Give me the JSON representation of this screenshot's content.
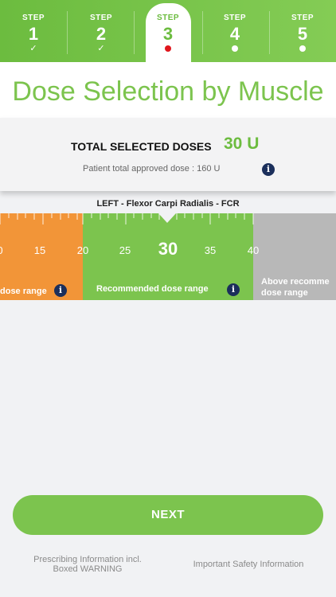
{
  "steps": [
    {
      "label": "STEP",
      "number": "1",
      "status": "✓"
    },
    {
      "label": "STEP",
      "number": "2",
      "status": "✓"
    },
    {
      "label": "STEP",
      "number": "3",
      "status": "current"
    },
    {
      "label": "STEP",
      "number": "4",
      "status": "pending"
    },
    {
      "label": "STEP",
      "number": "5",
      "status": "pending"
    }
  ],
  "title": "Dose Selection by Muscle",
  "summary": {
    "total_label": "TOTAL SELECTED DOSES",
    "total_value": "30 U",
    "approved_text": "Patient total approved dose : 160 U",
    "info_icon": "i"
  },
  "muscle": "LEFT - Flexor Carpi Radialis - FCR",
  "ruler": {
    "selected": "30",
    "ticks": [
      "0",
      "15",
      "20",
      "25",
      "35",
      "40"
    ],
    "low_label": "dose range",
    "recommended_label": "Recommended dose range",
    "high_label_line1": "Above recomme",
    "high_label_line2": "dose range",
    "colors": {
      "low": "#f29538",
      "recommended": "#7cc44e",
      "high": "#b8b8b8"
    }
  },
  "next_label": "NEXT",
  "footer": {
    "prescribing_line1": "Prescribing Information incl.",
    "prescribing_line2": "Boxed WARNING",
    "safety": "Important Safety Information"
  },
  "colors": {
    "accent": "#7cc44e",
    "current_dot": "#e0161d",
    "info": "#1b2f5b"
  }
}
